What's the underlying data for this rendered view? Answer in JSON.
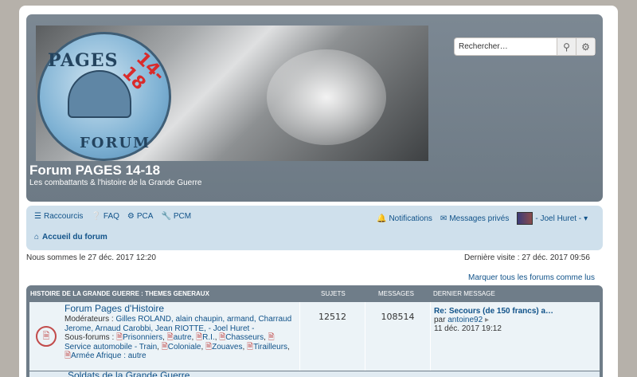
{
  "header": {
    "site_title": "Forum PAGES 14-18",
    "site_desc": "Les combattants & l'histoire de la Grande Guerre",
    "logo": {
      "word1": "PAGES",
      "word2": "14-18",
      "word3": "FORUM"
    },
    "search": {
      "placeholder": "Rechercher…",
      "value": "Rechercher…"
    }
  },
  "nav": {
    "items": [
      {
        "label": "Raccourcis",
        "icon": "bars-icon"
      },
      {
        "label": "FAQ",
        "icon": "question-icon"
      },
      {
        "label": "PCA",
        "icon": "cogs-icon"
      },
      {
        "label": "PCM",
        "icon": "wrench-icon"
      }
    ],
    "notifications": "Notifications",
    "messages": "Messages privés",
    "user": "- Joel Huret -",
    "breadcrumb": "Accueil du forum"
  },
  "meta": {
    "now": "Nous sommes le 27 déc. 2017 12:20",
    "last_visit": "Dernière visite : 27 déc. 2017 09:56",
    "mark_read": "Marquer tous les forums comme lus"
  },
  "forum": {
    "headers": {
      "category": "HISTOIRE DE LA GRANDE GUERRE : THEMES GENERAUX",
      "topics": "SUJETS",
      "posts": "MESSAGES",
      "last": "DERNIER MESSAGE"
    },
    "rows": [
      {
        "title": "Forum Pages d'Histoire",
        "moderators_label": "Modérateurs :",
        "moderators": "Gilles ROLAND, alain chaupin, armand, Charraud Jerome, Arnaud Carobbi, Jean RIOTTE, - Joel Huret -",
        "subforums_label": "Sous-forums :",
        "subforums": [
          "Prisonniers",
          "autre",
          "R.I.",
          "Chasseurs",
          "Service automobile - Train",
          "Coloniale",
          "Zouaves",
          "Tirailleurs",
          "Armée Afrique : autre"
        ],
        "topics": "12512",
        "posts": "108514",
        "last_title": "Re: Secours (de 150 francs) a…",
        "last_by_label": "par",
        "last_by": "antoine92",
        "last_date": "11 déc. 2017 19:12"
      }
    ],
    "next_title": "Soldats de la Grande Guerre"
  }
}
